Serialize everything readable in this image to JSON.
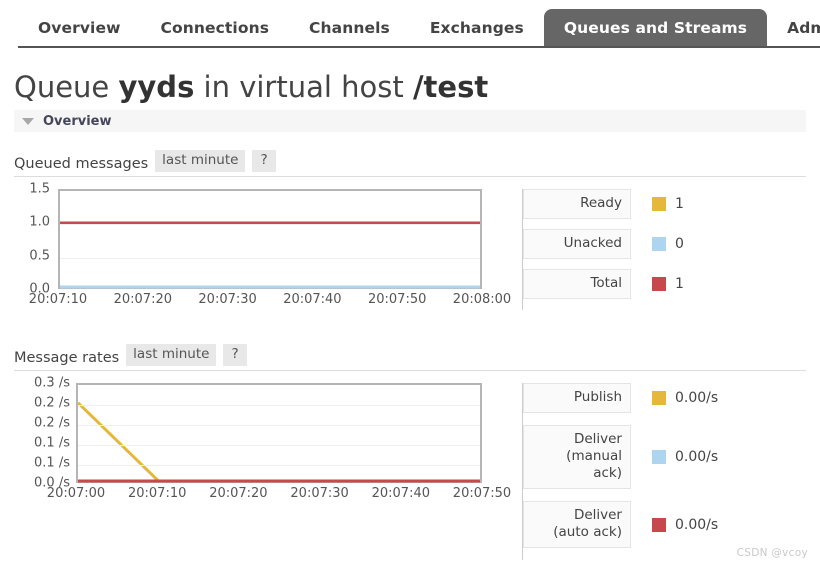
{
  "nav": {
    "tabs": [
      {
        "label": "Overview",
        "active": false
      },
      {
        "label": "Connections",
        "active": false
      },
      {
        "label": "Channels",
        "active": false
      },
      {
        "label": "Exchanges",
        "active": false
      },
      {
        "label": "Queues and Streams",
        "active": true
      },
      {
        "label": "Adm",
        "active": false
      }
    ]
  },
  "page": {
    "title_prefix": "Queue ",
    "title_queue": "yyds",
    "title_middle": " in virtual host ",
    "title_vhost": "/test",
    "section_overview": "Overview"
  },
  "queued": {
    "title": "Queued messages",
    "period": "last minute",
    "help": "?",
    "legend": [
      {
        "name": "Ready",
        "value": "1",
        "color": "#e5b73b"
      },
      {
        "name": "Unacked",
        "value": "0",
        "color": "#aed5f0"
      },
      {
        "name": "Total",
        "value": "1",
        "color": "#c8494b"
      }
    ]
  },
  "rates": {
    "title": "Message rates",
    "period": "last minute",
    "help": "?",
    "legend": [
      {
        "name": "Publish",
        "value": "0.00/s",
        "color": "#e5b73b"
      },
      {
        "name": "Deliver\n(manual\nack)",
        "value": "0.00/s",
        "color": "#aed5f0"
      },
      {
        "name": "Deliver\n(auto ack)",
        "value": "0.00/s",
        "color": "#c8494b"
      }
    ]
  },
  "watermark": "CSDN @vcoy",
  "chart_data": [
    {
      "type": "line",
      "name": "queued-messages",
      "title": "Queued messages",
      "xlabel": "",
      "ylabel": "",
      "period": "last minute",
      "x": [
        "20:07:10",
        "20:07:20",
        "20:07:30",
        "20:07:40",
        "20:07:50",
        "20:08:00"
      ],
      "xtick_labels": [
        "20:07:10",
        "20:07:20",
        "20:07:30",
        "20:07:40",
        "20:07:50",
        "20:08:00"
      ],
      "ytick_labels": [
        "0.0",
        "0.5",
        "1.0",
        "1.5"
      ],
      "ylim": [
        0.0,
        1.5
      ],
      "grid": true,
      "legend_position": "right",
      "series": [
        {
          "name": "Ready",
          "color": "#e5b73b",
          "values": [
            1,
            1,
            1,
            1,
            1,
            1
          ],
          "current": 1
        },
        {
          "name": "Unacked",
          "color": "#aed5f0",
          "values": [
            0,
            0,
            0,
            0,
            0,
            0
          ],
          "current": 0
        },
        {
          "name": "Total",
          "color": "#c8494b",
          "values": [
            1,
            1,
            1,
            1,
            1,
            1
          ],
          "current": 1
        }
      ]
    },
    {
      "type": "line",
      "name": "message-rates",
      "title": "Message rates",
      "xlabel": "",
      "ylabel": "/s",
      "period": "last minute",
      "x": [
        "20:07:00",
        "20:07:10",
        "20:07:20",
        "20:07:30",
        "20:07:40",
        "20:07:50"
      ],
      "xtick_labels": [
        "20:07:00",
        "20:07:10",
        "20:07:20",
        "20:07:30",
        "20:07:40",
        "20:07:50"
      ],
      "ytick_labels": [
        "0.0 /s",
        "0.1 /s",
        "0.1 /s",
        "0.2 /s",
        "0.2 /s",
        "0.3 /s"
      ],
      "ylim": [
        0.0,
        0.27
      ],
      "grid": true,
      "legend_position": "right",
      "series": [
        {
          "name": "Publish",
          "color": "#e5b73b",
          "values": [
            0.22,
            0.0,
            0.0,
            0.0,
            0.0,
            0.0
          ],
          "current": "0.00/s"
        },
        {
          "name": "Deliver (manual ack)",
          "color": "#aed5f0",
          "values": [
            0,
            0,
            0,
            0,
            0,
            0
          ],
          "current": "0.00/s"
        },
        {
          "name": "Deliver (auto ack)",
          "color": "#c8494b",
          "values": [
            0,
            0,
            0,
            0,
            0,
            0
          ],
          "current": "0.00/s"
        }
      ]
    }
  ]
}
